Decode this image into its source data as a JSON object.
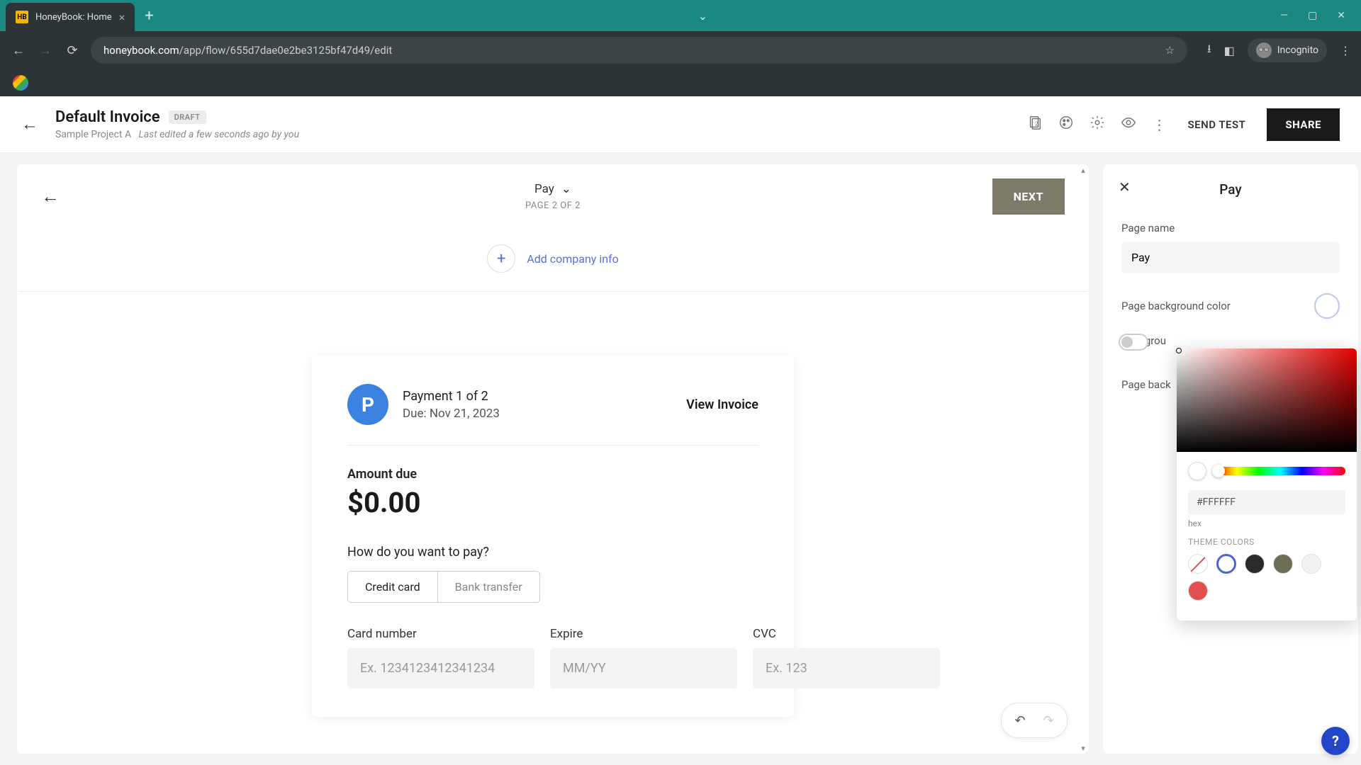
{
  "browser": {
    "tab_title": "HoneyBook: Home",
    "url_domain": "honeybook.com",
    "url_path": "/app/flow/655d7dae0e2be3125bf47d49/edit",
    "incognito_label": "Incognito"
  },
  "header": {
    "title": "Default Invoice",
    "badge": "DRAFT",
    "project": "Sample Project A",
    "edited": "Last edited a few seconds ago by you",
    "send_test": "SEND TEST",
    "share": "SHARE"
  },
  "canvas": {
    "page_name": "Pay",
    "page_counter": "PAGE 2 OF 2",
    "next": "NEXT",
    "add_company": "Add company info"
  },
  "pay": {
    "badge_letter": "P",
    "payment_title": "Payment 1 of 2",
    "due": "Due: Nov 21, 2023",
    "view_invoice": "View Invoice",
    "amount_label": "Amount due",
    "amount_value": "$0.00",
    "question": "How do you want to pay?",
    "method_credit": "Credit card",
    "method_bank": "Bank transfer",
    "card_label": "Card number",
    "card_ph": "Ex. 1234123412341234",
    "expire_label": "Expire",
    "expire_ph": "MM/YY",
    "cvc_label": "CVC",
    "cvc_ph": "Ex. 123"
  },
  "panel": {
    "title": "Pay",
    "page_name_label": "Page name",
    "page_name_value": "Pay",
    "bg_color_label": "Page background color",
    "bg_label_trunc": "Backgrou",
    "page_back_trunc": "Page back"
  },
  "picker": {
    "hex": "#FFFFFF",
    "hex_label": "hex",
    "theme_label": "THEME COLORS",
    "swatches": [
      "#ffffff",
      "#2a2a2a",
      "#6d6d55",
      "#f2f2f2",
      "#e24f4f"
    ]
  },
  "help": "?"
}
